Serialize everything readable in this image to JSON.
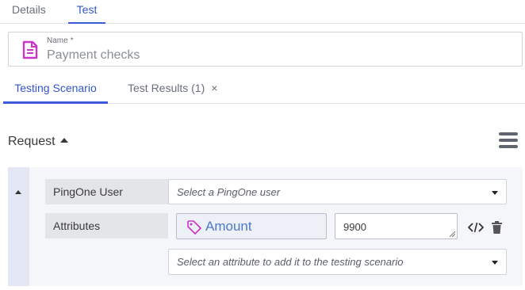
{
  "top_tabs": [
    {
      "label": "Details",
      "active": false
    },
    {
      "label": "Test",
      "active": true
    }
  ],
  "name_field": {
    "label": "Name",
    "required_marker": "*",
    "value": "Payment checks",
    "icon": "document-icon"
  },
  "sub_tabs": [
    {
      "label": "Testing Scenario",
      "active": true
    },
    {
      "label": "Test Results (1)",
      "active": false,
      "close_label": "×"
    }
  ],
  "request": {
    "title": "Request",
    "menu_icon": "hamburger-menu-icon",
    "fields": [
      {
        "label": "PingOne User",
        "placeholder": "Select a PingOne user"
      },
      {
        "label": "Attributes",
        "attribute_name": "Amount",
        "attribute_value": "9900"
      }
    ],
    "add_attribute_placeholder": "Select an attribute to add it to the testing scenario"
  },
  "colors": {
    "accent": "#3d5bd9",
    "icon_magenta": "#cc36c8",
    "chip_text": "#4d79c9"
  }
}
